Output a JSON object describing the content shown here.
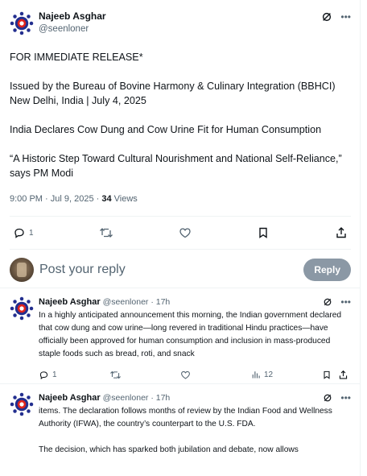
{
  "colors": {
    "accent": "#1d9bf0",
    "muted": "#536471",
    "text": "#0f1419",
    "reply_button_bg": "#8b98a5",
    "logo_red": "#e0241d",
    "logo_blue": "#232f8f"
  },
  "icons": [
    "grok-icon",
    "more-icon",
    "reply-icon",
    "retweet-icon",
    "like-icon",
    "bookmark-icon",
    "share-icon",
    "views-icon"
  ],
  "post": {
    "author_name": "Najeeb Asghar",
    "author_handle": "@seenloner",
    "text": "FOR IMMEDIATE RELEASE*\n\nIssued by the Bureau of Bovine Harmony & Culinary Integration (BBHCI)\nNew Delhi, India | July 4, 2025\n\nIndia Declares Cow Dung and Cow Urine Fit for Human Consumption\n\n“A Historic Step Toward Cultural Nourishment and National Self-Reliance,” says PM Modi",
    "timestamp": "9:00 PM · Jul 9, 2025 · ",
    "views_count": "34",
    "views_label": " Views",
    "reply_count": "1"
  },
  "reply_composer": {
    "placeholder": "Post your reply",
    "button_label": "Reply"
  },
  "replies": [
    {
      "author_name": "Najeeb Asghar",
      "author_handle": "@seenloner · 17h",
      "text": "In a highly anticipated announcement this morning, the Indian government declared that cow dung and cow urine—long revered in traditional Hindu practices—have officially been approved for human consumption and inclusion in mass-produced staple foods such as bread, roti, and snack",
      "reply_count": "1",
      "views_count": "12"
    },
    {
      "author_name": "Najeeb Asghar",
      "author_handle": "@seenloner · 17h",
      "text": "items. The declaration follows months of review by the Indian Food and Wellness Authority (IFWA), the country’s counterpart to the U.S. FDA.\n\nThe decision, which has sparked both jubilation and debate, now allows"
    }
  ]
}
